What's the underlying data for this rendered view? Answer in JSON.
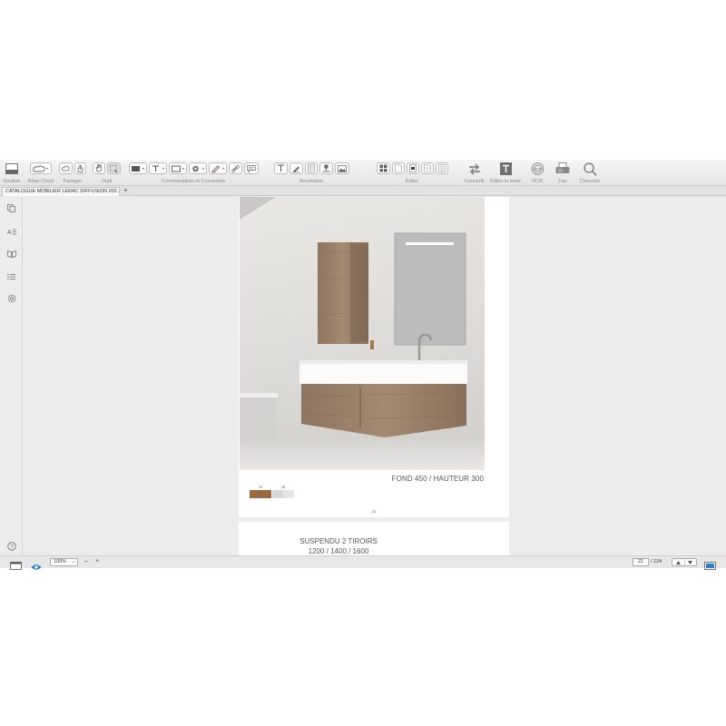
{
  "toolbar": {
    "groups": {
      "gestion": "Gestion",
      "kdan_cloud": "Kdan Cloud",
      "partager": "Partager",
      "outil": "Outil",
      "commentaires": "Commentaires et Connexion",
      "annotation": "Annotation",
      "editer": "Éditer",
      "convertir": "Convertir",
      "editer_texte": "Éditer le texte",
      "ocr": "OCR",
      "fax": "Fax",
      "chercher": "Chercher"
    }
  },
  "tabs": {
    "active_label": "CATALOGUE MOBILIER LERAC DIFFUSION 202...",
    "add_label": "+"
  },
  "document": {
    "page1": {
      "caption": "FOND 450 / HAUTEUR 300",
      "swatch_labels": [
        "19",
        "28"
      ],
      "swatch_colors": [
        "#9a6a3c",
        "#d8d8d8",
        "#e6e6e6"
      ],
      "page_number": "21"
    },
    "page2": {
      "title_line1": "SUSPENDU 2 TIROIRS",
      "title_line2": "1200 / 1400 / 1600"
    }
  },
  "statusbar": {
    "zoom_value": "100%",
    "zoom_out_label": "–",
    "zoom_in_label": "+",
    "current_page": "21",
    "total_pages": "/ 224"
  },
  "colors": {
    "toolbar_bg": "#ededed",
    "canvas_bg": "#ececec",
    "accent": "#2a7fd4"
  }
}
